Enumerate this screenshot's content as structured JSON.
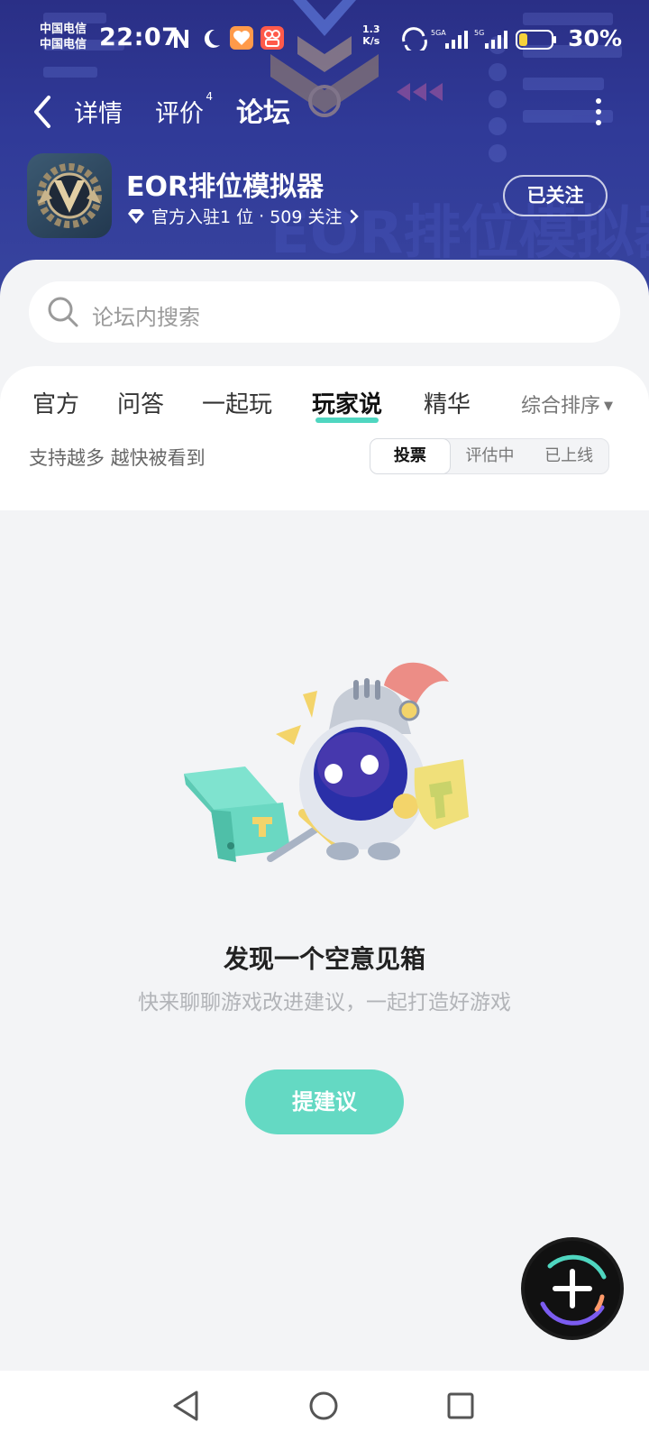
{
  "status_bar": {
    "carrier_1": "中国电信",
    "carrier_2": "中国电信",
    "time": "22:07",
    "net_speed_value": "1.3",
    "net_speed_unit": "K/s",
    "battery_percent": "30%"
  },
  "nav": {
    "tabs": [
      {
        "label": "详情"
      },
      {
        "label": "评价",
        "badge": "4"
      },
      {
        "label": "论坛"
      }
    ]
  },
  "app": {
    "name": "EOR排位模拟器",
    "meta_official": "官方入驻1 位",
    "meta_separator": "·",
    "meta_follow_count": "509 关注",
    "follow_button": "已关注"
  },
  "search": {
    "placeholder": "论坛内搜索"
  },
  "forum_tabs": [
    {
      "label": "官方"
    },
    {
      "label": "问答"
    },
    {
      "label": "一起玩"
    },
    {
      "label": "玩家说"
    },
    {
      "label": "精华"
    }
  ],
  "sort_label": "综合排序",
  "subtitle": "支持越多 越快被看到",
  "segments": [
    {
      "label": "投票"
    },
    {
      "label": "评估中"
    },
    {
      "label": "已上线"
    }
  ],
  "empty_state": {
    "title": "发现一个空意见箱",
    "description": "快来聊聊游戏改进建议，一起打造好游戏",
    "button": "提建议"
  },
  "colors": {
    "accent": "#4fd6c0",
    "button": "#64d9c3",
    "header_bg": "#2f3790"
  }
}
